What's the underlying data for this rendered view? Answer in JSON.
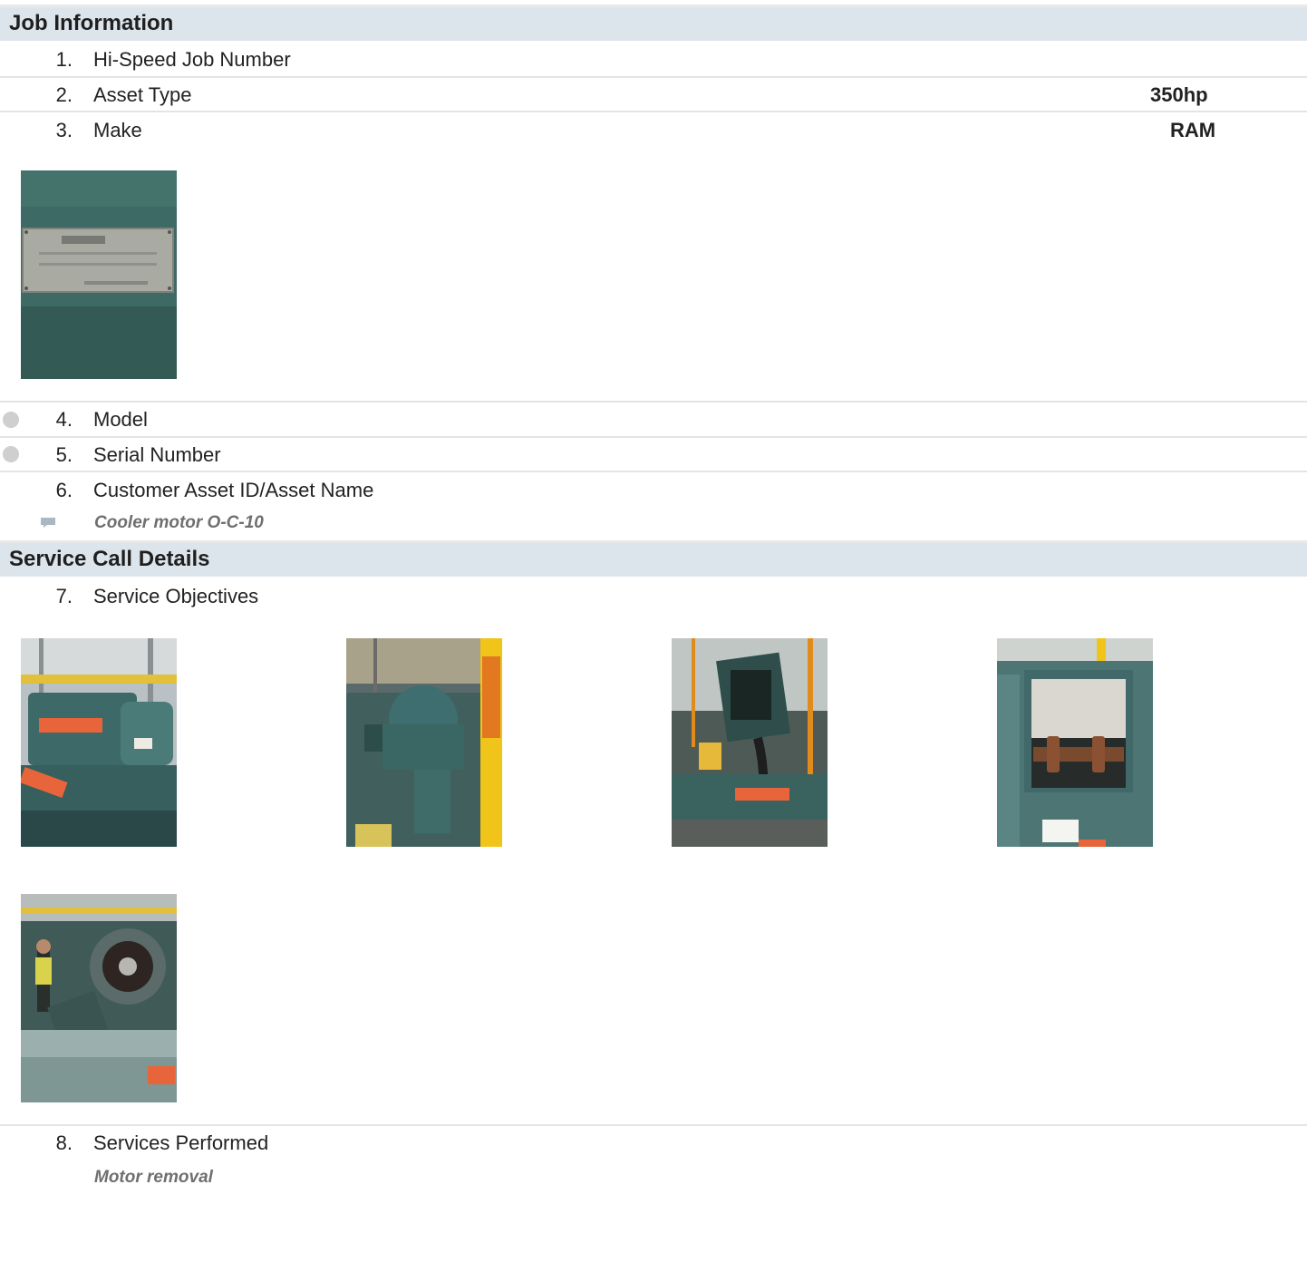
{
  "job_information": {
    "header": "Job Information",
    "items": [
      {
        "num": "1.",
        "label": "Hi-Speed Job Number",
        "answer": ""
      },
      {
        "num": "2.",
        "label": "Asset Type",
        "answer": "350hp"
      },
      {
        "num": "3.",
        "label": "Make",
        "answer": "RAM"
      },
      {
        "num": "4.",
        "label": "Model",
        "answer": ""
      },
      {
        "num": "5.",
        "label": "Serial Number",
        "answer": ""
      },
      {
        "num": "6.",
        "label": "Customer Asset ID/Asset Name",
        "answer": ""
      }
    ],
    "asset_note": "Cooler motor O-C-10"
  },
  "service_call_details": {
    "header": "Service Call Details",
    "items": [
      {
        "num": "7.",
        "label": "Service Objectives"
      },
      {
        "num": "8.",
        "label": "Services Performed"
      }
    ],
    "services_note": "Motor removal"
  },
  "photos": {
    "nameplate": "nameplate-photo",
    "objectives": [
      "motor-side-photo",
      "compressor-photo",
      "junction-box-photo",
      "coupling-photo",
      "motor-removed-photo"
    ]
  },
  "colors": {
    "header_bg": "#dde5ec",
    "divider": "#e4e4e4",
    "note_text": "#6f6f6f",
    "machine_teal": "#3f6e6c",
    "warning_orange": "#e8643a",
    "pipe_yellow": "#f0c419"
  }
}
